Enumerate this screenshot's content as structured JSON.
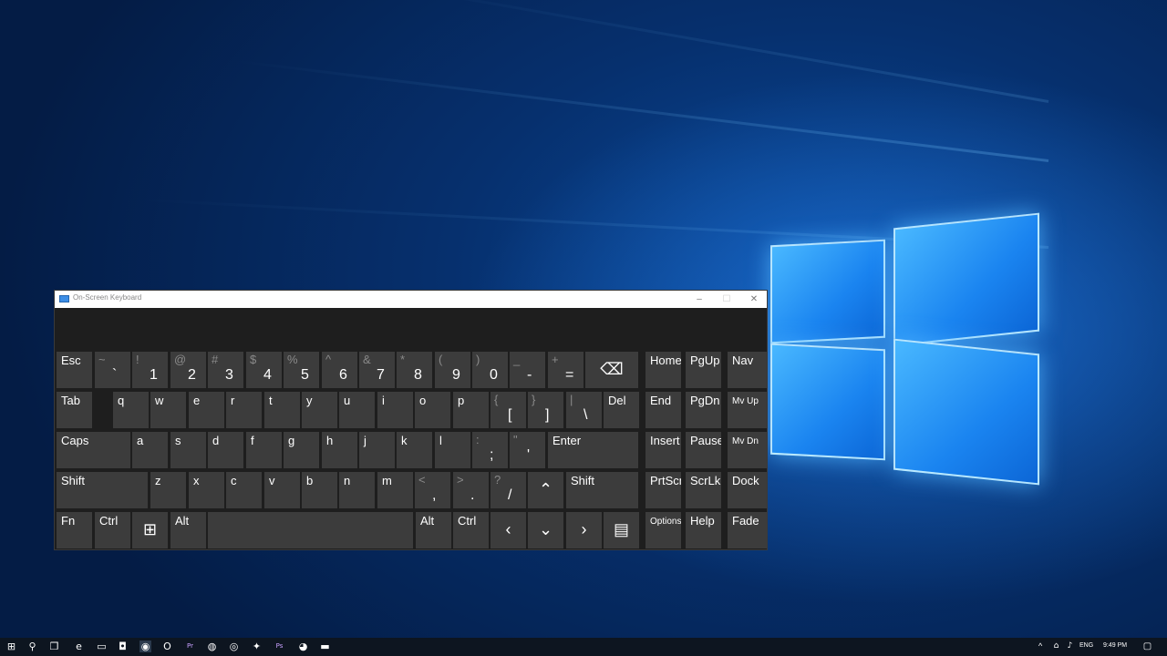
{
  "window": {
    "title": "On-Screen Keyboard",
    "minimize": "–",
    "maximize": "☐",
    "close": "✕"
  },
  "keys": [
    {
      "label": "Esc"
    },
    {
      "shift": "~",
      "main": "`"
    },
    {
      "shift": "!",
      "main": "1"
    },
    {
      "shift": "@",
      "main": "2"
    },
    {
      "shift": "#",
      "main": "3"
    },
    {
      "shift": "$",
      "main": "4"
    },
    {
      "shift": "%",
      "main": "5"
    },
    {
      "shift": "^",
      "main": "6"
    },
    {
      "shift": "&",
      "main": "7"
    },
    {
      "shift": "*",
      "main": "8"
    },
    {
      "shift": "(",
      "main": "9"
    },
    {
      "shift": ")",
      "main": "0"
    },
    {
      "shift": "_",
      "main": "-"
    },
    {
      "shift": "+",
      "main": "="
    },
    {
      "icon": "backspace-icon",
      "glyph": "⌫"
    },
    {
      "label": "Home"
    },
    {
      "label": "PgUp"
    },
    {
      "label": "Nav"
    },
    {
      "label": "Tab"
    },
    {
      "label": "q"
    },
    {
      "label": "w"
    },
    {
      "label": "e"
    },
    {
      "label": "r"
    },
    {
      "label": "t"
    },
    {
      "label": "y"
    },
    {
      "label": "u"
    },
    {
      "label": "i"
    },
    {
      "label": "o"
    },
    {
      "label": "p"
    },
    {
      "shift": "{",
      "main": "["
    },
    {
      "shift": "}",
      "main": "]"
    },
    {
      "shift": "|",
      "main": "\\"
    },
    {
      "label": "Del"
    },
    {
      "label": "End"
    },
    {
      "label": "PgDn"
    },
    {
      "label": "Mv Up"
    },
    {
      "label": "Caps"
    },
    {
      "label": "a"
    },
    {
      "label": "s"
    },
    {
      "label": "d"
    },
    {
      "label": "f"
    },
    {
      "label": "g"
    },
    {
      "label": "h"
    },
    {
      "label": "j"
    },
    {
      "label": "k"
    },
    {
      "label": "l"
    },
    {
      "shift": ":",
      "main": ";"
    },
    {
      "shift": "\"",
      "main": "'"
    },
    {
      "label": "Enter"
    },
    {
      "label": "Insert"
    },
    {
      "label": "Pause"
    },
    {
      "label": "Mv Dn"
    },
    {
      "label": "Shift"
    },
    {
      "label": "z"
    },
    {
      "label": "x"
    },
    {
      "label": "c"
    },
    {
      "label": "v"
    },
    {
      "label": "b"
    },
    {
      "label": "n"
    },
    {
      "label": "m"
    },
    {
      "shift": "<",
      "main": ","
    },
    {
      "shift": ">",
      "main": "."
    },
    {
      "shift": "?",
      "main": "/"
    },
    {
      "icon": "arrow-up-icon",
      "glyph": "⌃"
    },
    {
      "label": "Shift"
    },
    {
      "label": "PrtScn"
    },
    {
      "label": "ScrLk"
    },
    {
      "label": "Dock"
    },
    {
      "label": "Fn"
    },
    {
      "label": "Ctrl"
    },
    {
      "icon": "windows-key-icon",
      "glyph": "⊞"
    },
    {
      "label": "Alt"
    },
    {
      "label": ""
    },
    {
      "label": "Alt"
    },
    {
      "label": "Ctrl"
    },
    {
      "icon": "arrow-left-icon",
      "glyph": "‹"
    },
    {
      "icon": "arrow-down-icon",
      "glyph": "⌄"
    },
    {
      "icon": "arrow-right-icon",
      "glyph": "›"
    },
    {
      "icon": "menu-key-icon",
      "glyph": "▤"
    },
    {
      "label": "Options"
    },
    {
      "label": "Help"
    },
    {
      "label": "Fade"
    }
  ],
  "taskbar": {
    "icons": [
      {
        "name": "start-icon",
        "glyph": "⊞"
      },
      {
        "name": "search-icon",
        "glyph": "⚲"
      },
      {
        "name": "task-view-icon",
        "glyph": "❐"
      },
      {
        "name": "edge-icon",
        "glyph": "e"
      },
      {
        "name": "file-explorer-icon",
        "glyph": "▭"
      },
      {
        "name": "store-icon",
        "glyph": "◘"
      },
      {
        "name": "chrome-icon",
        "glyph": "◉"
      },
      {
        "name": "opera-icon",
        "glyph": "O"
      },
      {
        "name": "premiere-icon",
        "glyph": "Pr"
      },
      {
        "name": "app-icon",
        "glyph": "◍"
      },
      {
        "name": "steam-icon",
        "glyph": "◎"
      },
      {
        "name": "app2-icon",
        "glyph": "✦"
      },
      {
        "name": "photoshop-icon",
        "glyph": "Ps"
      },
      {
        "name": "app3-icon",
        "glyph": "◕"
      },
      {
        "name": "osk-icon",
        "glyph": "▬"
      }
    ],
    "tray": {
      "chevron": "^",
      "language": "ENG",
      "time": "9:49 PM",
      "notification_glyph": "▢"
    }
  }
}
